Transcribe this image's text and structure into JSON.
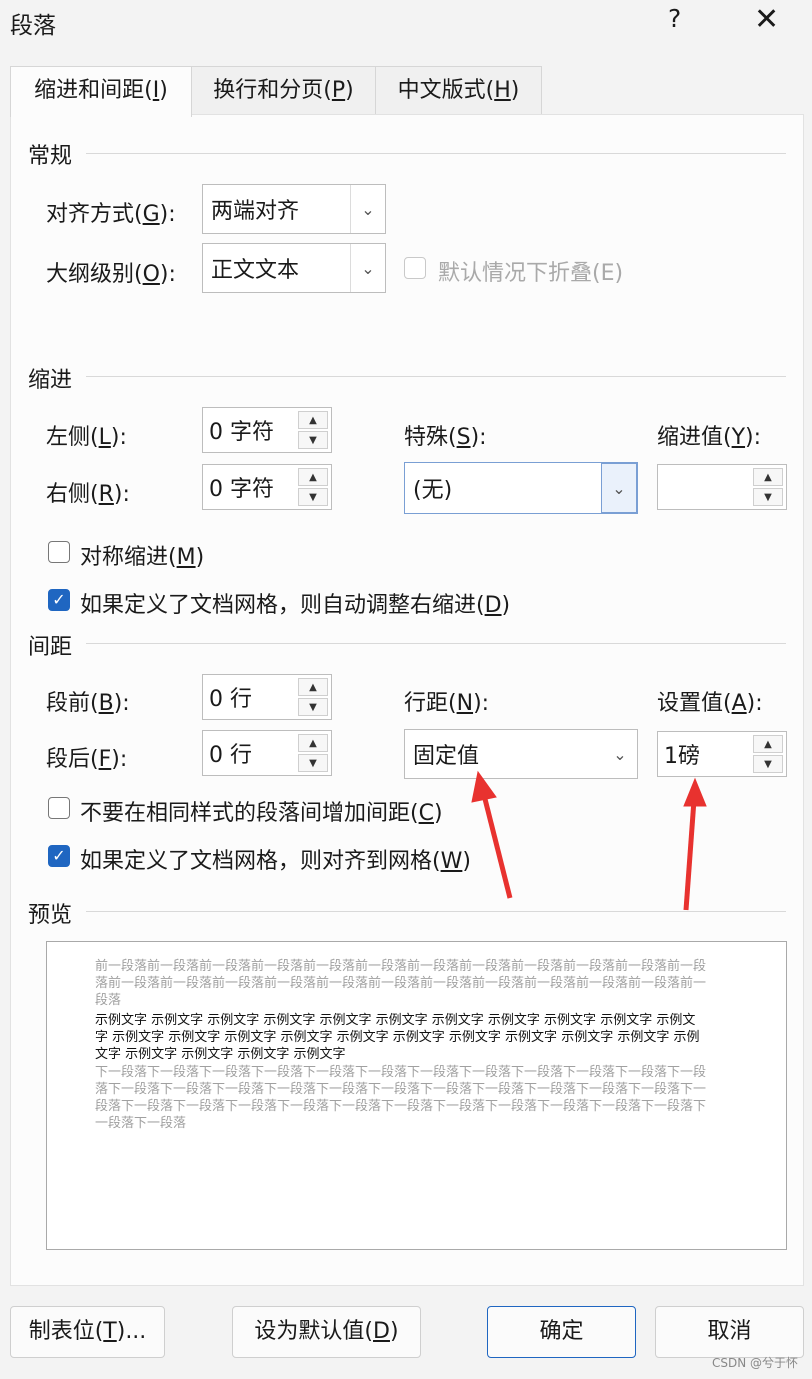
{
  "window": {
    "title": "段落",
    "help_label": "?",
    "close_label": "✕"
  },
  "tabs": [
    {
      "label": "缩进和间距(",
      "key": "I",
      "end": ")",
      "active": true
    },
    {
      "label": "换行和分页(",
      "key": "P",
      "end": ")",
      "active": false
    },
    {
      "label": "中文版式(",
      "key": "H",
      "end": ")",
      "active": false
    }
  ],
  "general": {
    "heading": "常规",
    "alignment": {
      "label": "对齐方式(",
      "key": "G",
      "end": "):",
      "value": "两端对齐"
    },
    "outline": {
      "label": "大纲级别(",
      "key": "O",
      "end": "):",
      "value": "正文文本"
    },
    "collapse": {
      "label": "默认情况下折叠(E)",
      "checked": false,
      "disabled": true
    }
  },
  "indent": {
    "heading": "缩进",
    "left": {
      "label": "左侧(",
      "key": "L",
      "end": "):",
      "value": "0 字符"
    },
    "right": {
      "label": "右侧(",
      "key": "R",
      "end": "):",
      "value": "0 字符"
    },
    "special": {
      "label": "特殊(",
      "key": "S",
      "end": "):",
      "value": "(无)"
    },
    "by": {
      "label": "缩进值(",
      "key": "Y",
      "end": "):",
      "value": ""
    },
    "mirror": {
      "label": "对称缩进(",
      "key": "M",
      "end": ")",
      "checked": false
    },
    "auto_adjust": {
      "label": "如果定义了文档网格，则自动调整右缩进(",
      "key": "D",
      "end": ")",
      "checked": true
    }
  },
  "spacing": {
    "heading": "间距",
    "before": {
      "label": "段前(",
      "key": "B",
      "end": "):",
      "value": "0 行"
    },
    "after": {
      "label": "段后(",
      "key": "F",
      "end": "):",
      "value": "0 行"
    },
    "line_spacing": {
      "label": "行距(",
      "key": "N",
      "end": "):",
      "value": "固定值"
    },
    "at": {
      "label": "设置值(",
      "key": "A",
      "end": "):",
      "value": "1磅"
    },
    "no_space_same_style": {
      "label": "不要在相同样式的段落间增加间距(",
      "key": "C",
      "end": ")",
      "checked": false
    },
    "snap_to_grid": {
      "label": "如果定义了文档网格，则对齐到网格(",
      "key": "W",
      "end": ")",
      "checked": true
    }
  },
  "preview": {
    "heading": "预览",
    "prev_text": "前一段落前一段落前一段落前一段落前一段落前一段落前一段落前一段落前一段落前一段落前一段落前一段落前一段落前一段落前一段落前一段落前一段落前一段落前一段落前一段落前一段落前一段落前一段落前一段落",
    "sample_text": "示例文字 示例文字 示例文字 示例文字 示例文字 示例文字 示例文字 示例文字 示例文字 示例文字 示例文字 示例文字 示例文字 示例文字 示例文字 示例文字 示例文字 示例文字 示例文字 示例文字 示例文字 示例文字 示例文字 示例文字 示例文字 示例文字",
    "next_text": "下一段落下一段落下一段落下一段落下一段落下一段落下一段落下一段落下一段落下一段落下一段落下一段落下一段落下一段落下一段落下一段落下一段落下一段落下一段落下一段落下一段落下一段落下一段落下一段落下一段落下一段落下一段落下一段落下一段落下一段落下一段落下一段落下一段落下一段落下一段落下一段落下一段落"
  },
  "buttons": {
    "tabs_label": "制表位(",
    "tabs_key": "T",
    "tabs_end": ")...",
    "default_label": "设为默认值(",
    "default_key": "D",
    "default_end": ")",
    "ok": "确定",
    "cancel": "取消"
  },
  "watermark": "CSDN @兮于怀",
  "colors": {
    "accent": "#1f66c1",
    "annotation_arrow": "#e8322f"
  }
}
